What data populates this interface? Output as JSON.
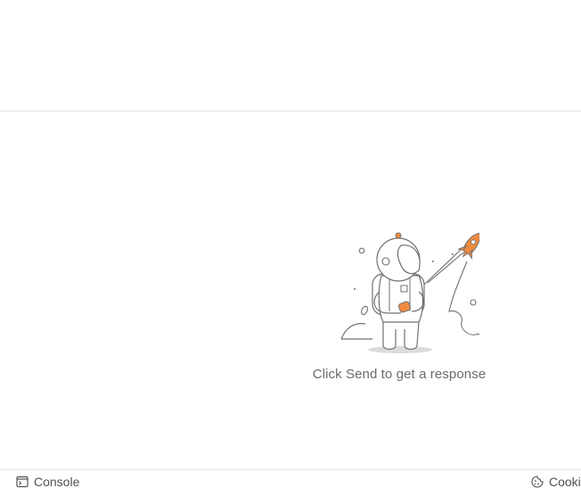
{
  "response": {
    "empty_message": "Click Send to get a response"
  },
  "status_bar": {
    "console_label": "Console",
    "cookies_label": "Cookies"
  },
  "colors": {
    "accent_orange": "#F08B3E",
    "outline_gray": "#707070",
    "divider": "#E6E6E6"
  },
  "icons": {
    "console": "console-icon",
    "cookies": "cookie-icon"
  }
}
